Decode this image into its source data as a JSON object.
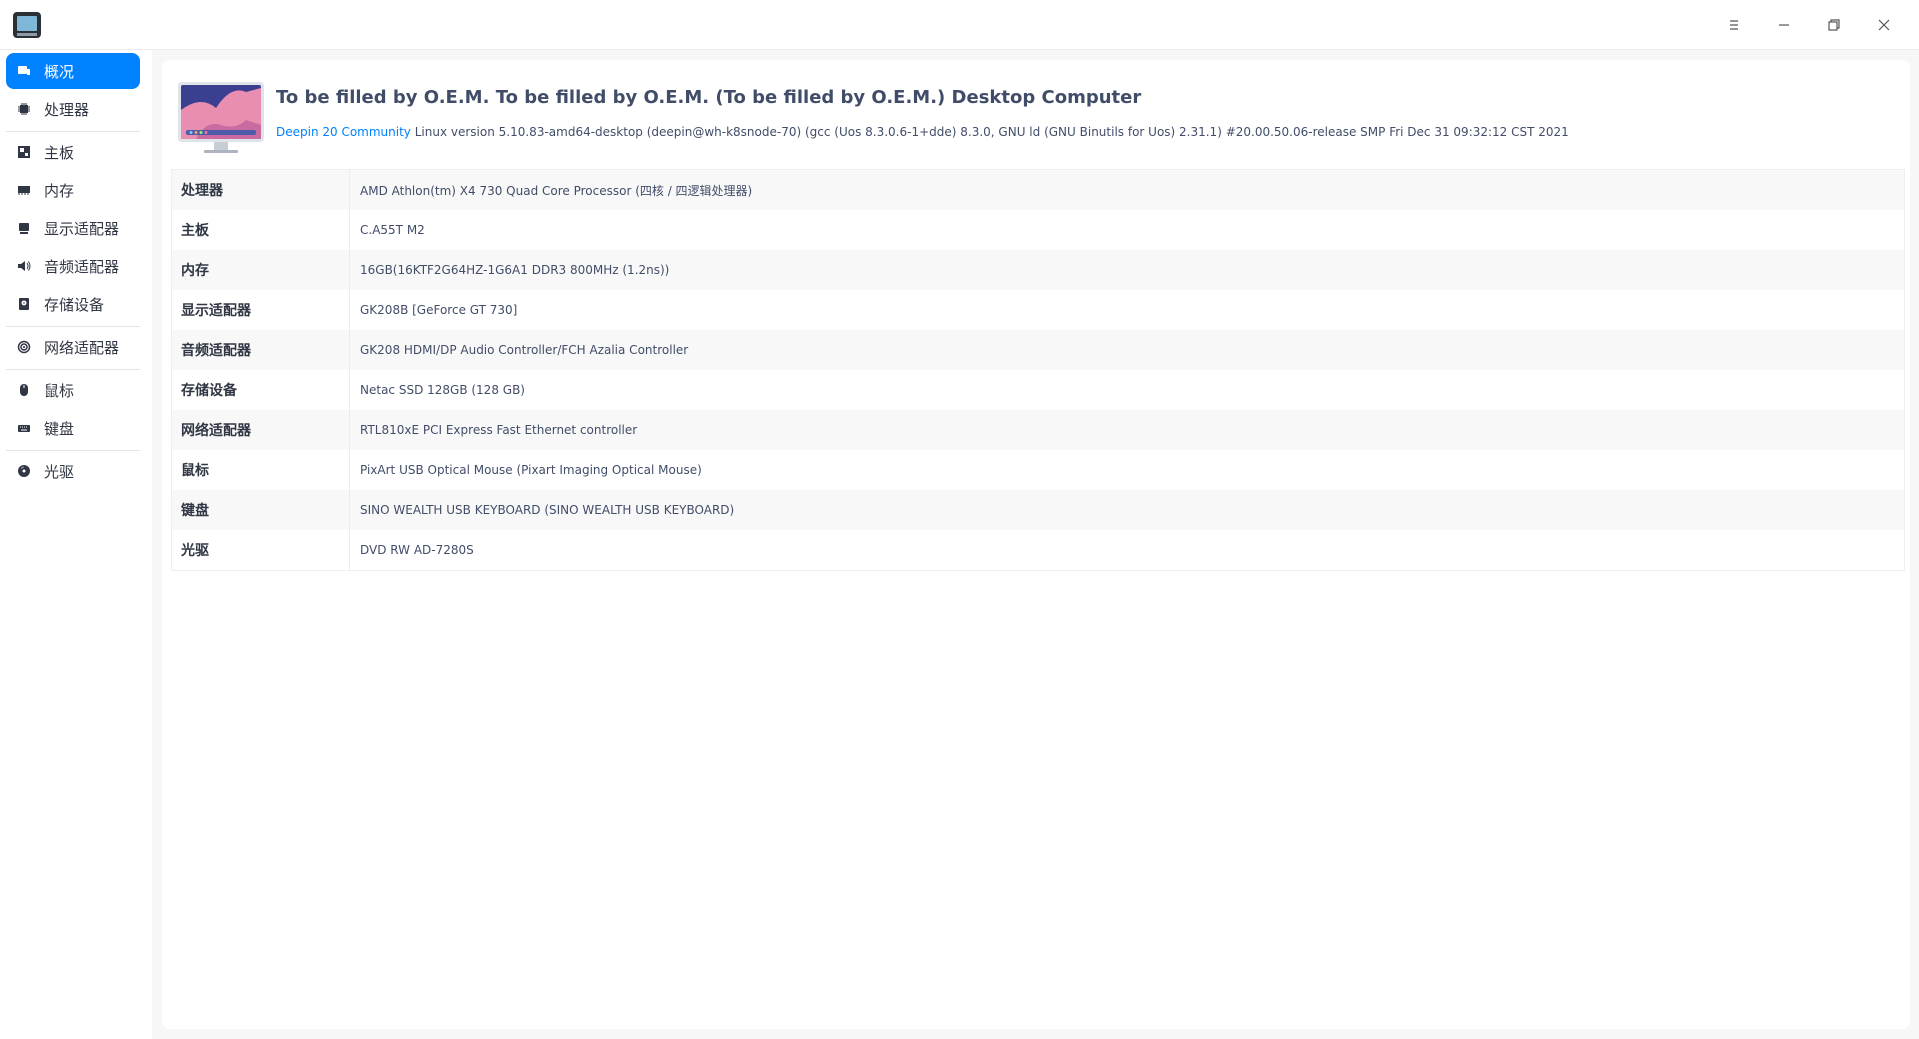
{
  "app": {
    "icon": "computer-monitor-icon"
  },
  "window_controls": [
    {
      "name": "menu-button",
      "icon": "hamburger-menu-icon"
    },
    {
      "name": "minimize-button",
      "icon": "minimize-icon"
    },
    {
      "name": "restore-button",
      "icon": "restore-icon"
    },
    {
      "name": "close-button",
      "icon": "close-icon"
    }
  ],
  "sidebar": {
    "accent": "#0081ff",
    "items": [
      {
        "label": "概况",
        "icon": "overview-icon",
        "active": true
      },
      {
        "label": "处理器",
        "icon": "cpu-icon"
      },
      {
        "label": "主板",
        "icon": "motherboard-icon"
      },
      {
        "label": "内存",
        "icon": "memory-icon"
      },
      {
        "label": "显示适配器",
        "icon": "display-adapter-icon"
      },
      {
        "label": "音频适配器",
        "icon": "audio-icon"
      },
      {
        "label": "存储设备",
        "icon": "storage-icon"
      },
      {
        "label": "网络适配器",
        "icon": "network-icon"
      },
      {
        "label": "鼠标",
        "icon": "mouse-icon"
      },
      {
        "label": "键盘",
        "icon": "keyboard-icon"
      },
      {
        "label": "光驱",
        "icon": "optical-drive-icon"
      }
    ]
  },
  "overview": {
    "title": "To be filled by O.E.M. To be filled by O.E.M. (To be filled by O.E.M.) Desktop Computer",
    "os_link": "Deepin 20 Community",
    "os_detail": " Linux version 5.10.83-amd64-desktop (deepin@wh-k8snode-70) (gcc (Uos 8.3.0.6-1+dde) 8.3.0, GNU ld (GNU Binutils for Uos) 2.31.1) #20.00.50.06-release SMP Fri Dec 31 09:32:12 CST 2021",
    "rows": [
      {
        "key": "处理器",
        "value": "AMD Athlon(tm) X4 730 Quad Core Processor (四核 / 四逻辑处理器)"
      },
      {
        "key": "主板",
        "value": "C.A55T M2"
      },
      {
        "key": "内存",
        "value": "16GB(16KTF2G64HZ-1G6A1 DDR3 800MHz (1.2ns))"
      },
      {
        "key": "显示适配器",
        "value": "GK208B [GeForce GT 730]"
      },
      {
        "key": "音频适配器",
        "value": "GK208 HDMI/DP Audio Controller/FCH Azalia Controller"
      },
      {
        "key": "存储设备",
        "value": "Netac SSD 128GB (128 GB)"
      },
      {
        "key": "网络适配器",
        "value": "RTL810xE PCI Express Fast Ethernet controller"
      },
      {
        "key": "鼠标",
        "value": "PixArt USB Optical Mouse (Pixart Imaging Optical Mouse)"
      },
      {
        "key": "键盘",
        "value": "SINO WEALTH USB KEYBOARD (SINO WEALTH USB KEYBOARD)"
      },
      {
        "key": "光驱",
        "value": "DVD RW AD-7280S"
      }
    ]
  }
}
